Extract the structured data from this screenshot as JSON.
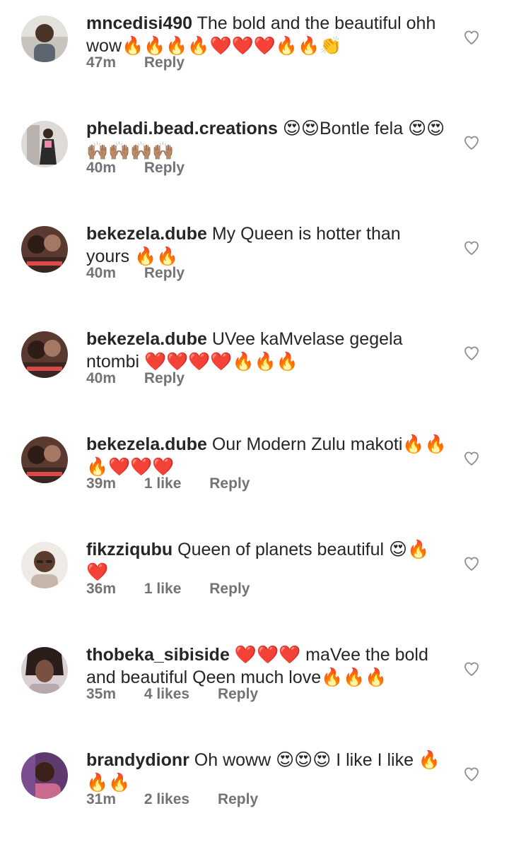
{
  "comments": [
    {
      "username": "mncedisi490",
      "text": "The bold and the beautiful ohh wow🔥🔥🔥🔥❤️❤️❤️🔥🔥👏",
      "time": "47m",
      "likes": "",
      "reply": "Reply",
      "avatar_color": "#8a7d72"
    },
    {
      "username": "pheladi.bead.creations",
      "text": "😍😍Bontle fela 😍😍🙌🏽🙌🏽🙌🏽🙌🏽",
      "time": "40m",
      "likes": "",
      "reply": "Reply",
      "avatar_color": "#b8b0ac"
    },
    {
      "username": "bekezela.dube",
      "text": "My Queen is hotter than yours 🔥🔥",
      "time": "40m",
      "likes": "",
      "reply": "Reply",
      "avatar_color": "#6b4a3c"
    },
    {
      "username": "bekezela.dube",
      "text": "UVee kaMvelase gegela ntombi ❤️❤️❤️❤️🔥🔥🔥",
      "time": "40m",
      "likes": "",
      "reply": "Reply",
      "avatar_color": "#6b4a3c"
    },
    {
      "username": "bekezela.dube",
      "text": "Our Modern Zulu makoti🔥🔥🔥❤️❤️❤️",
      "time": "39m",
      "likes": "1 like",
      "reply": "Reply",
      "avatar_color": "#6b4a3c"
    },
    {
      "username": "fikzziqubu",
      "text": "Queen of planets beautiful 😍🔥❤️",
      "time": "36m",
      "likes": "1 like",
      "reply": "Reply",
      "avatar_color": "#d9d2cc"
    },
    {
      "username": "thobeka_sibiside",
      "text": "❤️❤️❤️ maVee the bold and beautiful Qeen much love🔥🔥🔥",
      "time": "35m",
      "likes": "4 likes",
      "reply": "Reply",
      "avatar_color": "#cfc6c8"
    },
    {
      "username": "brandydionr",
      "text": "Oh woww 😍😍😍 I like I like 🔥🔥🔥",
      "time": "31m",
      "likes": "2 likes",
      "reply": "Reply",
      "avatar_color": "#7a4d8a"
    }
  ],
  "colors": {
    "text": "#262626",
    "meta": "#737373",
    "heart_outline": "#8e8e8e"
  },
  "icons": [
    "avatar",
    "heart-outline-icon"
  ]
}
